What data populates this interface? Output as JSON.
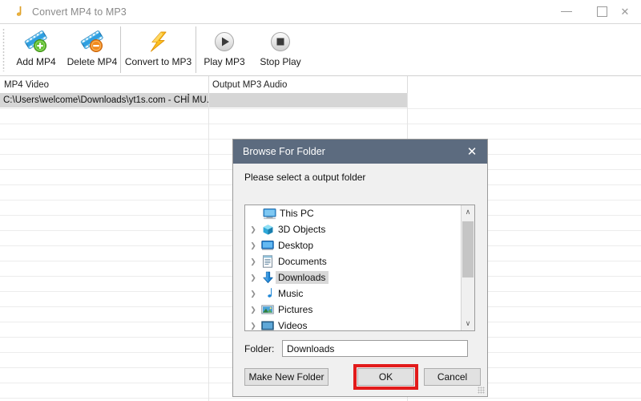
{
  "window": {
    "title": "Convert MP4 to MP3",
    "icon": "music-note-icon",
    "controls": {
      "minimize": "–",
      "maximize": "□",
      "close": "✕"
    }
  },
  "toolbar": {
    "items": [
      {
        "label": "Add MP4",
        "icon": "film-add-icon"
      },
      {
        "label": "Delete MP4",
        "icon": "film-delete-icon"
      },
      {
        "label": "Convert to MP3",
        "icon": "lightning-bolt-icon"
      },
      {
        "label": "Play MP3",
        "icon": "play-icon"
      },
      {
        "label": "Stop Play",
        "icon": "stop-icon"
      }
    ]
  },
  "grid": {
    "columns": [
      "MP4 Video",
      "Output MP3 Audio"
    ],
    "rows": [
      {
        "mp4": "C:\\Users\\welcome\\Downloads\\yt1s.com - CHỈ MU...",
        "mp3": "",
        "selected": true
      }
    ]
  },
  "dialog": {
    "title": "Browse For Folder",
    "close_icon": "✕",
    "prompt": "Please select a output folder",
    "tree": [
      {
        "label": "This PC",
        "icon": "this-pc-icon",
        "arrow": "",
        "depth": 0,
        "selected": false
      },
      {
        "label": "3D Objects",
        "icon": "3d-objects-icon",
        "arrow": "❯",
        "depth": 1,
        "selected": false
      },
      {
        "label": "Desktop",
        "icon": "desktop-icon",
        "arrow": "❯",
        "depth": 1,
        "selected": false
      },
      {
        "label": "Documents",
        "icon": "documents-icon",
        "arrow": "❯",
        "depth": 1,
        "selected": false
      },
      {
        "label": "Downloads",
        "icon": "downloads-icon",
        "arrow": "❯",
        "depth": 1,
        "selected": true
      },
      {
        "label": "Music",
        "icon": "music-icon",
        "arrow": "❯",
        "depth": 1,
        "selected": false
      },
      {
        "label": "Pictures",
        "icon": "pictures-icon",
        "arrow": "❯",
        "depth": 1,
        "selected": false
      },
      {
        "label": "Videos",
        "icon": "videos-icon",
        "arrow": "❯",
        "depth": 1,
        "selected": false
      }
    ],
    "scrollbar": {
      "up": "∧",
      "down": "∨"
    },
    "folder_label": "Folder:",
    "folder_value": "Downloads",
    "buttons": {
      "make_new_folder": "Make New Folder",
      "ok": "OK",
      "cancel": "Cancel"
    },
    "highlight_color": "#e21b1b"
  }
}
